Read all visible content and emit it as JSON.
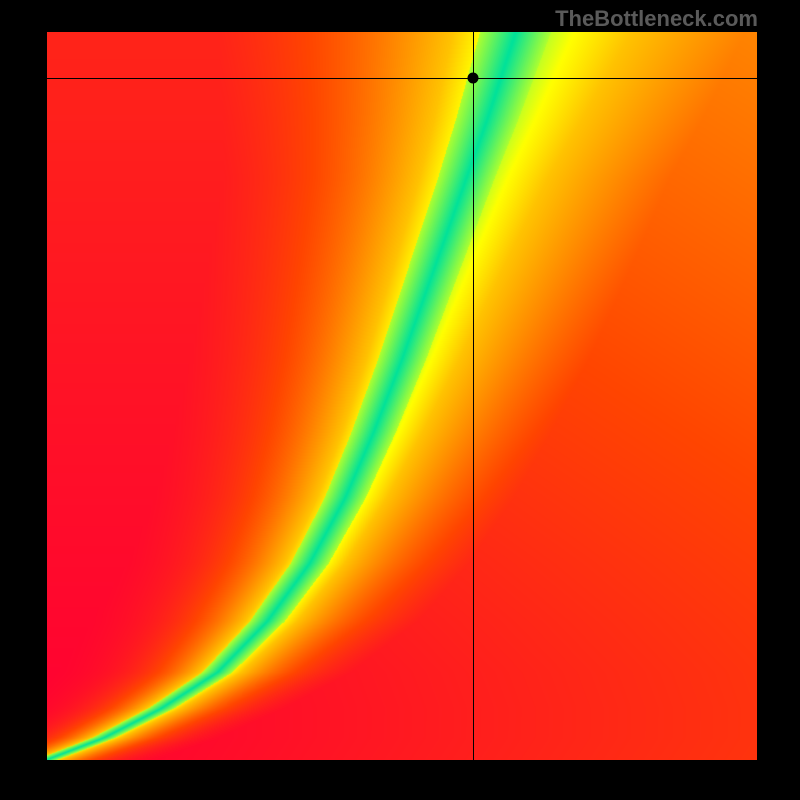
{
  "watermark": "TheBottleneck.com",
  "chart_data": {
    "type": "heatmap",
    "title": "",
    "xlabel": "",
    "ylabel": "",
    "xlim": [
      0,
      1
    ],
    "ylim": [
      0,
      1
    ],
    "marker": {
      "x": 0.6,
      "y": 0.937
    },
    "crosshair": {
      "x": 0.6,
      "y": 0.937
    },
    "ridge": [
      {
        "x": 0.0,
        "y": 0.0
      },
      {
        "x": 0.08,
        "y": 0.03
      },
      {
        "x": 0.16,
        "y": 0.07
      },
      {
        "x": 0.24,
        "y": 0.12
      },
      {
        "x": 0.31,
        "y": 0.19
      },
      {
        "x": 0.37,
        "y": 0.27
      },
      {
        "x": 0.42,
        "y": 0.36
      },
      {
        "x": 0.46,
        "y": 0.45
      },
      {
        "x": 0.5,
        "y": 0.55
      },
      {
        "x": 0.54,
        "y": 0.66
      },
      {
        "x": 0.58,
        "y": 0.77
      },
      {
        "x": 0.62,
        "y": 0.88
      },
      {
        "x": 0.66,
        "y": 1.0
      }
    ],
    "ridge_width": [
      {
        "y": 0.0,
        "w": 0.015
      },
      {
        "y": 0.2,
        "w": 0.025
      },
      {
        "y": 0.4,
        "w": 0.03
      },
      {
        "y": 0.6,
        "w": 0.035
      },
      {
        "y": 0.8,
        "w": 0.04
      },
      {
        "y": 1.0,
        "w": 0.05
      }
    ],
    "colorscale": [
      {
        "v": 0.0,
        "color": "#FF0033"
      },
      {
        "v": 0.3,
        "color": "#FF4500"
      },
      {
        "v": 0.55,
        "color": "#FF8C00"
      },
      {
        "v": 0.75,
        "color": "#FFC300"
      },
      {
        "v": 0.88,
        "color": "#FFFF00"
      },
      {
        "v": 0.95,
        "color": "#ADFF2F"
      },
      {
        "v": 1.0,
        "color": "#00E29A"
      }
    ]
  }
}
